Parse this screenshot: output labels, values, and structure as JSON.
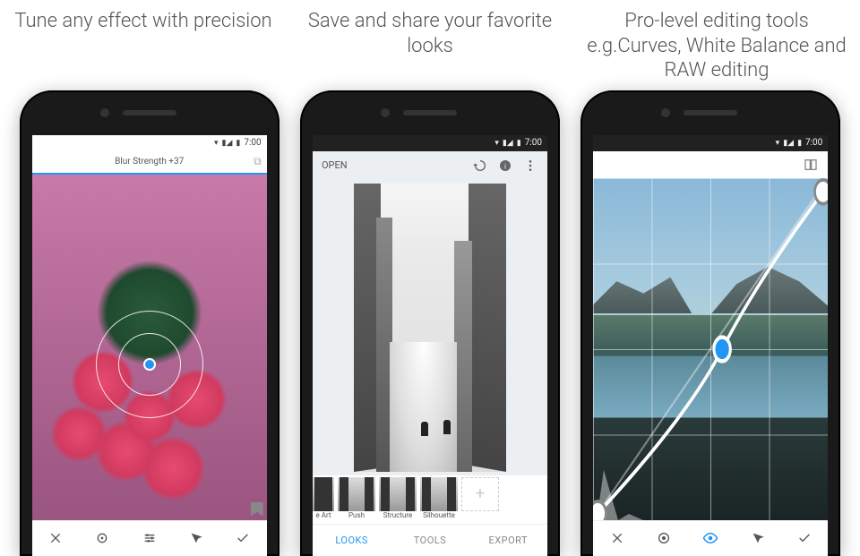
{
  "captions": [
    "Tune any effect with precision",
    "Save and share your favorite looks",
    "Pro-level editing tools e.g.Curves, White Balance and RAW editing"
  ],
  "status": {
    "time": "7:00",
    "wifi": "wifi",
    "signal": "signal",
    "battery": "battery"
  },
  "phone1": {
    "parameter_label": "Blur Strength +37",
    "bottom_icons": [
      "close",
      "target",
      "adjust",
      "styles",
      "confirm"
    ]
  },
  "phone2": {
    "open_label": "OPEN",
    "top_icons": [
      "layers",
      "info",
      "more"
    ],
    "thumbs": [
      {
        "label": "e Art"
      },
      {
        "label": "Push"
      },
      {
        "label": "Structure"
      },
      {
        "label": "Silhouette"
      }
    ],
    "add_label": "+",
    "tabs": [
      {
        "label": "LOOKS",
        "active": true
      },
      {
        "label": "TOOLS",
        "active": false
      },
      {
        "label": "EXPORT",
        "active": false
      }
    ]
  },
  "phone3": {
    "top_icon": "compare",
    "bottom_icons": [
      "close",
      "channel",
      "eye",
      "styles",
      "confirm"
    ],
    "active_icon_index": 2
  }
}
